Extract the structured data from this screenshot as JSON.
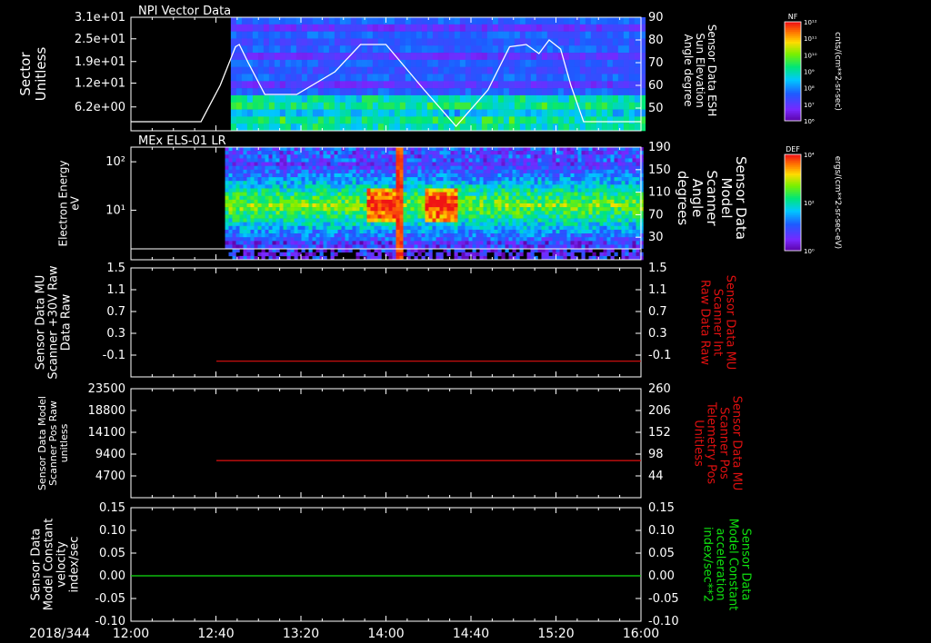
{
  "figure": {
    "date_label": "2018/344",
    "time_ticks": [
      "12:00",
      "12:40",
      "13:20",
      "14:00",
      "14:40",
      "15:20",
      "16:00"
    ]
  },
  "colors": {
    "white": "#ffffff",
    "red": "#e01010",
    "green": "#10e010",
    "background": "#000000"
  },
  "colorbars": [
    {
      "label": "NF",
      "unit": "cnts/(cm**2-sr-sec)",
      "tick_labels": [
        "10¹²",
        "10¹¹",
        "10¹⁰",
        "10⁹",
        "10⁸",
        "10⁷",
        "10⁶"
      ]
    },
    {
      "label": "DEF",
      "unit": "ergs/(cm**2-sr-sec-eV)",
      "tick_labels": [
        "10⁴",
        "10²",
        "10⁰"
      ]
    }
  ],
  "chart_data": [
    {
      "type": "heatmap",
      "title": "NPI Vector Data",
      "ylabel": "Sector Unitless",
      "yticks": [
        "3.1e+01",
        "2.5e+01",
        "1.9e+01",
        "1.2e+01",
        "6.2e+00"
      ],
      "y2label": "Sensor Data ESH Sun Elevation Angle degree",
      "y2ticks": [
        "90",
        "80",
        "70",
        "60",
        "50"
      ],
      "y2lim": [
        40,
        90
      ],
      "data_start_time": "12:47",
      "overlay_line": {
        "color": "white",
        "x_hours": [
          12.0,
          12.55,
          12.7,
          12.82,
          12.85,
          12.92,
          13.05,
          13.3,
          13.6,
          13.8,
          14.0,
          14.3,
          14.55,
          14.8,
          14.97,
          15.1,
          15.2,
          15.28,
          15.37,
          15.45,
          15.55,
          16.0
        ],
        "y_deg": [
          44,
          44,
          60,
          77,
          78,
          70,
          56,
          56,
          66,
          78,
          78,
          58,
          42,
          58,
          77,
          78,
          74,
          80,
          76,
          60,
          44,
          44
        ]
      }
    },
    {
      "type": "heatmap",
      "title": "MEx ELS-01 LR",
      "ylabel": "Electron Energy eV",
      "yticks": [
        "10²",
        "10¹"
      ],
      "y2label": "Sensor Data Model Scanner Angle degrees",
      "y2ticks": [
        "190",
        "150",
        "110",
        "70",
        "30"
      ],
      "data_start_time": "12:40"
    },
    {
      "type": "line",
      "ylabel": "Sensor Data MU Scanner +30V Raw Data Raw",
      "yticks": [
        "1.5",
        "1.1",
        "0.7",
        "0.3",
        "-0.1"
      ],
      "y2label": "Sensor Data MU Scanner Int Raw Data Raw",
      "y2ticks": [
        "1.5",
        "1.1",
        "0.7",
        "0.3",
        "-0.1"
      ],
      "ylim": [
        -0.3,
        1.5
      ],
      "series": [
        {
          "color": "red",
          "x_hours": [
            12.67,
            16.0
          ],
          "y": [
            -0.04,
            -0.04
          ]
        }
      ]
    },
    {
      "type": "line",
      "ylabel": "Sensor Data Model Scanner Pos Raw unitless",
      "yticks": [
        "23500",
        "18800",
        "14100",
        "9400",
        "4700"
      ],
      "y2label": "Sensor Data MU Scanner Pos Telemetry Pos Unitless",
      "y2ticks": [
        "260",
        "206",
        "152",
        "98",
        "44"
      ],
      "ylim": [
        0,
        23500
      ],
      "series": [
        {
          "color": "red",
          "x_hours": [
            12.67,
            16.0
          ],
          "y": [
            8000,
            8000
          ]
        }
      ]
    },
    {
      "type": "line",
      "ylabel": "Sensor Data Model Constant velocity index/sec",
      "yticks": [
        "0.15",
        "0.10",
        "0.05",
        "0.00",
        "-0.05",
        "-0.10"
      ],
      "y2label": "Sensor Data Model Constant acceleration index/sec**2",
      "y2ticks": [
        "0.15",
        "0.10",
        "0.05",
        "0.00",
        "-0.05",
        "-0.10"
      ],
      "ylim": [
        -0.1,
        0.15
      ],
      "series": [
        {
          "color": "green",
          "x_hours": [
            12.0,
            16.0
          ],
          "y": [
            0.0,
            0.0
          ]
        }
      ]
    }
  ]
}
